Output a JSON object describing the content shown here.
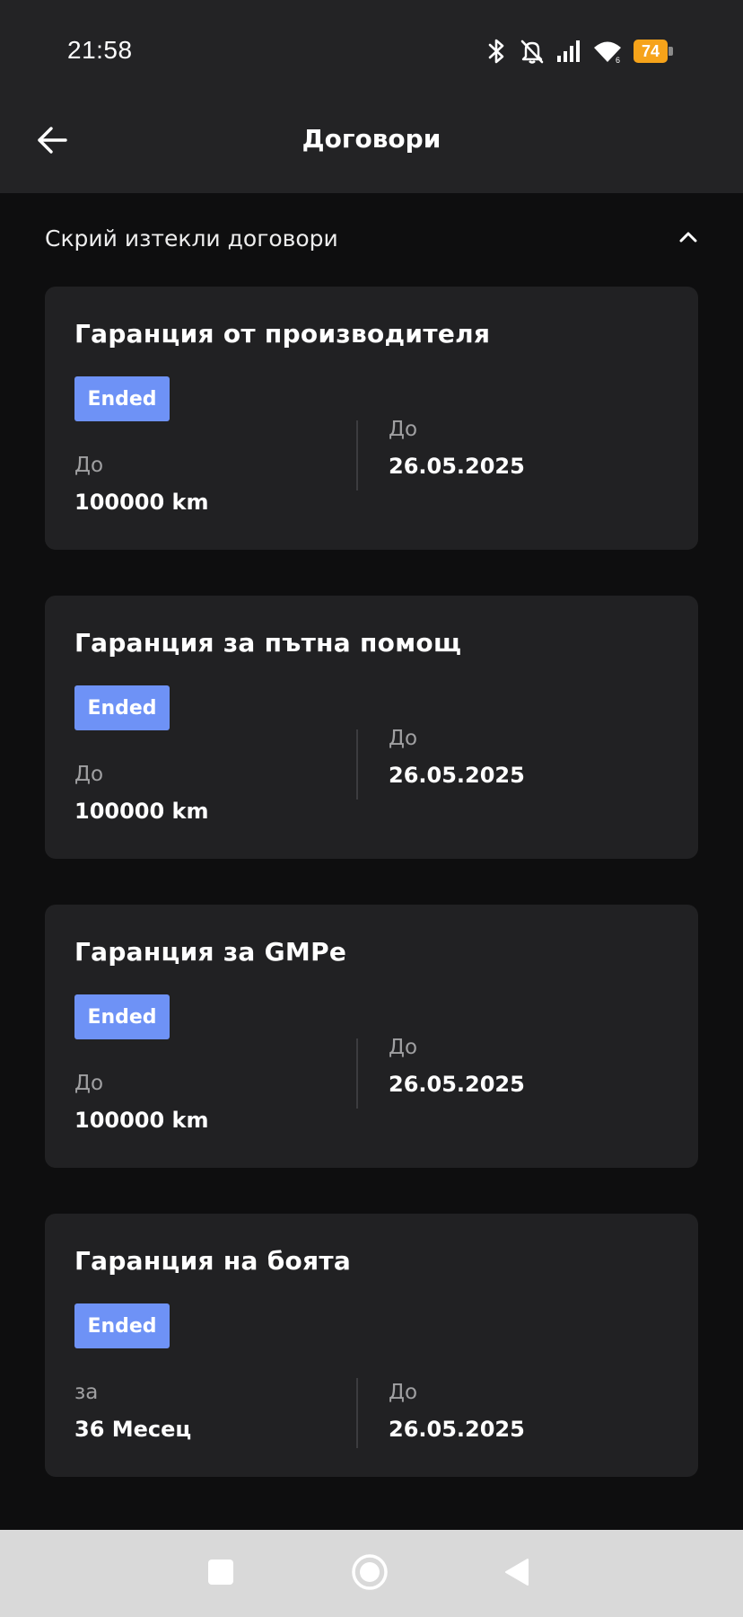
{
  "status_bar": {
    "time": "21:58",
    "icons": [
      "bluetooth-icon",
      "bell-muted-icon",
      "signal-icon",
      "wifi-icon"
    ],
    "battery_level": "74",
    "battery_color": "#f6a31a"
  },
  "app_bar": {
    "title": "Договори",
    "back_icon": "arrow-left-icon"
  },
  "toggle": {
    "label": "Скрий изтекли договори",
    "icon": "chevron-up-icon"
  },
  "contracts": [
    {
      "title": "Гаранция от производителя",
      "status": "Ended",
      "left_label": "До",
      "left_value": "100000 km",
      "right_label": "До",
      "right_value": "26.05.2025"
    },
    {
      "title": "Гаранция за пътна помощ",
      "status": "Ended",
      "left_label": "До",
      "left_value": "100000 km",
      "right_label": "До",
      "right_value": "26.05.2025"
    },
    {
      "title": "Гаранция за GMPe",
      "status": "Ended",
      "left_label": "До",
      "left_value": "100000 km",
      "right_label": "До",
      "right_value": "26.05.2025"
    },
    {
      "title": "Гаранция на боята",
      "status": "Ended",
      "left_label": "за",
      "left_value": "36 Месец",
      "right_label": "До",
      "right_value": "26.05.2025"
    }
  ],
  "colors": {
    "badge": "#6e92f6",
    "card": "#212123",
    "background": "#0e0e0f",
    "header": "#232325"
  },
  "nav_bar": {
    "buttons": [
      "recents-square-icon",
      "home-circle-icon",
      "back-triangle-icon"
    ]
  }
}
